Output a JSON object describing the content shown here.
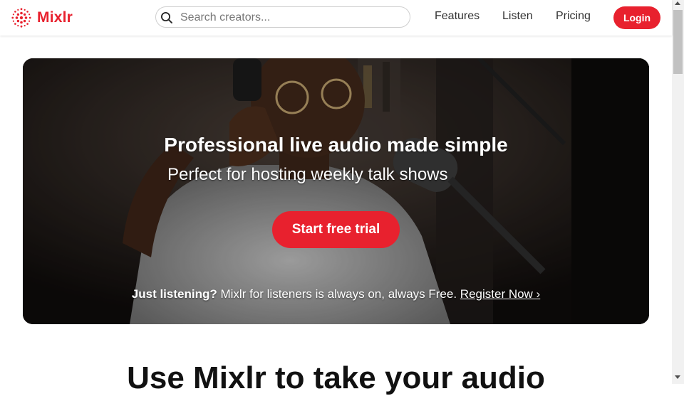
{
  "header": {
    "logo_text": "Mixlr",
    "brand_color": "#e8212e",
    "search": {
      "placeholder": "Search creators..."
    },
    "nav": [
      {
        "label": "Features"
      },
      {
        "label": "Listen"
      },
      {
        "label": "Pricing"
      }
    ],
    "login_label": "Login"
  },
  "hero": {
    "title": "Professional live audio made simple",
    "subtitle": "Perfect for hosting weekly talk shows",
    "cta_label": "Start free trial",
    "listeners": {
      "lead": "Just listening?",
      "text": " Mixlr for listeners is always on, always Free. ",
      "link": "Register Now ›"
    }
  },
  "section": {
    "heading": "Use Mixlr to take your audio"
  }
}
